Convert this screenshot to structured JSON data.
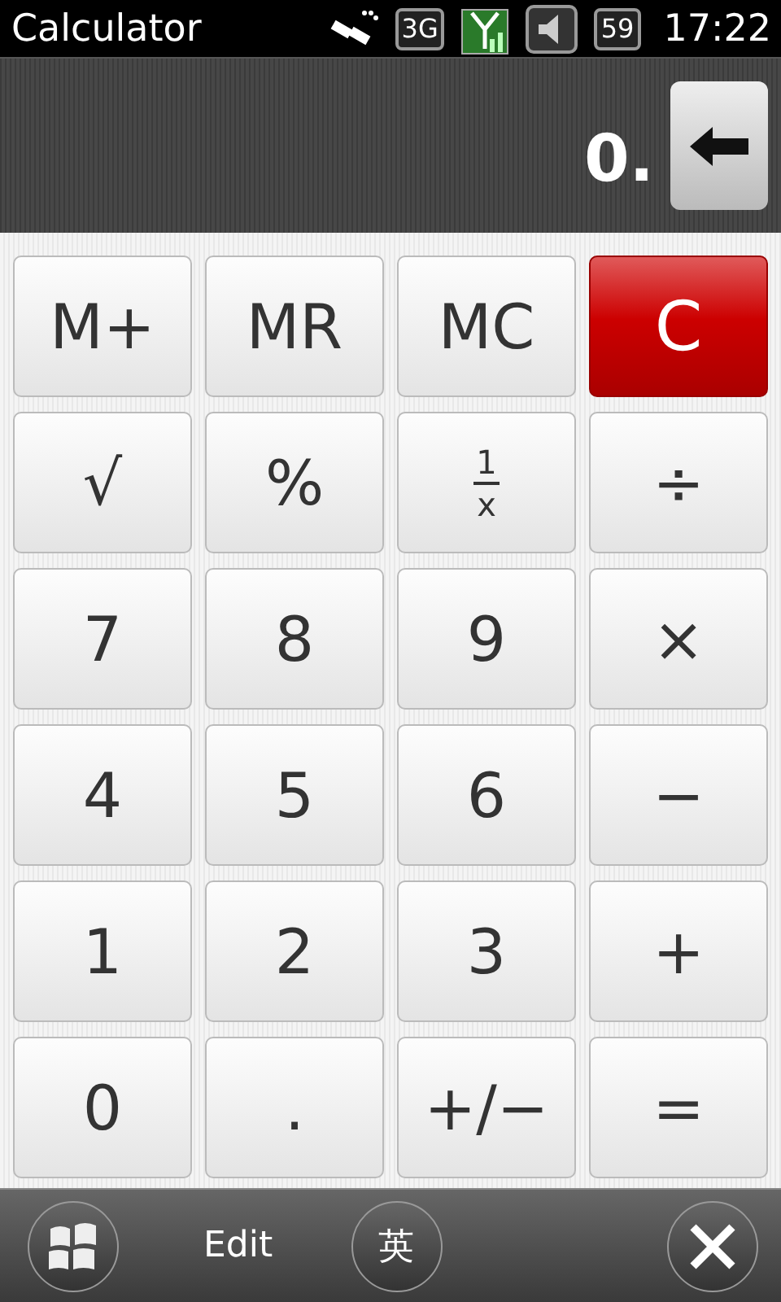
{
  "status_bar": {
    "title": "Calculator",
    "network": "3G",
    "battery": "59",
    "time": "17:22"
  },
  "display": {
    "value": "0."
  },
  "keys": [
    {
      "kind": "plain",
      "label": "M+"
    },
    {
      "kind": "plain",
      "label": "MR"
    },
    {
      "kind": "plain",
      "label": "MC"
    },
    {
      "kind": "clear",
      "label": "C"
    },
    {
      "kind": "plain",
      "label": "√"
    },
    {
      "kind": "plain",
      "label": "%"
    },
    {
      "kind": "fraction",
      "numerator": "1",
      "denominator": "x"
    },
    {
      "kind": "plain",
      "label": "÷"
    },
    {
      "kind": "plain",
      "label": "7"
    },
    {
      "kind": "plain",
      "label": "8"
    },
    {
      "kind": "plain",
      "label": "9"
    },
    {
      "kind": "plain",
      "label": "×"
    },
    {
      "kind": "plain",
      "label": "4"
    },
    {
      "kind": "plain",
      "label": "5"
    },
    {
      "kind": "plain",
      "label": "6"
    },
    {
      "kind": "plain",
      "label": "−"
    },
    {
      "kind": "plain",
      "label": "1"
    },
    {
      "kind": "plain",
      "label": "2"
    },
    {
      "kind": "plain",
      "label": "3"
    },
    {
      "kind": "plain",
      "label": "+"
    },
    {
      "kind": "plain",
      "label": "0"
    },
    {
      "kind": "plain",
      "label": "."
    },
    {
      "kind": "plain",
      "label": "+/−"
    },
    {
      "kind": "plain",
      "label": "="
    }
  ],
  "bottom_bar": {
    "menu": "Edit",
    "input_mode": "英"
  }
}
